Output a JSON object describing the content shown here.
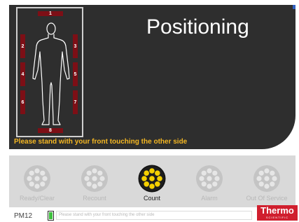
{
  "screen": {
    "title": "Positioning",
    "instruction": "Please stand with your front touching the other side"
  },
  "electrodes": [
    "1",
    "2",
    "3",
    "4",
    "5",
    "6",
    "7",
    "8"
  ],
  "buttons": [
    {
      "label": "Ready/Clear",
      "state": "disabled"
    },
    {
      "label": "Recount",
      "state": "disabled"
    },
    {
      "label": "Count",
      "state": "active"
    },
    {
      "label": "Alarm",
      "state": "disabled"
    },
    {
      "label": "Out Of Service",
      "state": "disabled"
    }
  ],
  "status_bar": {
    "device": "PM12",
    "battery_level": 1.0,
    "message": "Please stand with your front touching the other side"
  },
  "brand": {
    "name": "Thermo",
    "tagline": "SCIENTIFIC"
  },
  "colors": {
    "panel": "#2e2e2e",
    "instruction": "#f5b722",
    "pad": "#7d0f16",
    "active_button": "#f5d000",
    "disabled_button": "#c4c4c4",
    "brand": "#d01f2e",
    "battery": "#3fc13f"
  },
  "icons": [
    "human-silhouette-icon",
    "detector-icon",
    "battery-icon"
  ]
}
